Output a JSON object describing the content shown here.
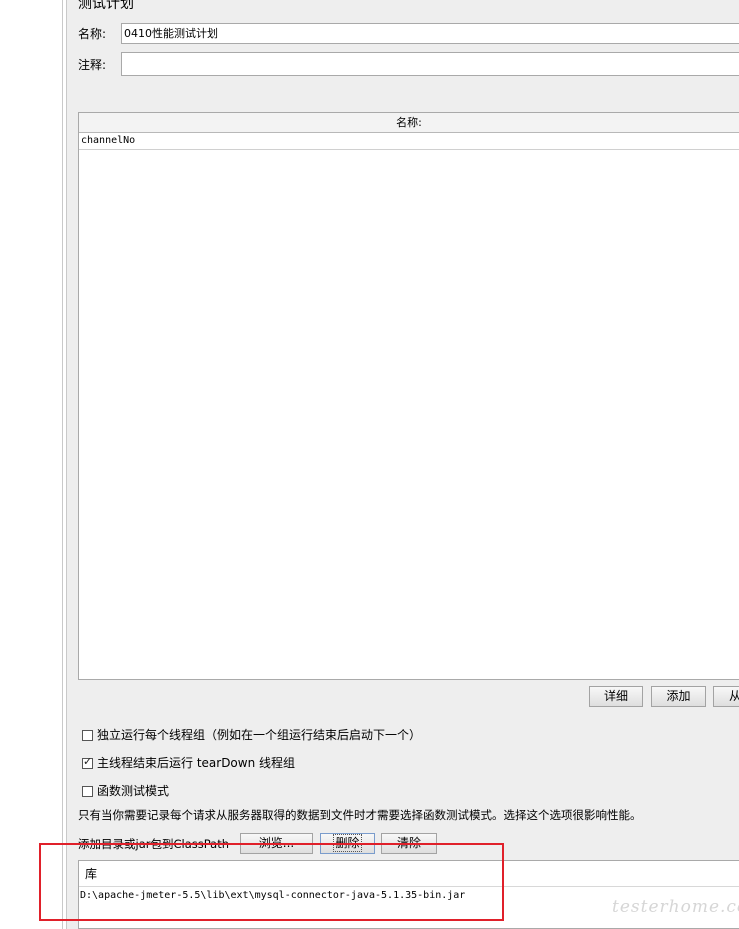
{
  "panel": {
    "title": "测试计划",
    "name_label": "名称:",
    "name_value": "0410性能测试计划",
    "comment_label": "注释:",
    "comment_value": ""
  },
  "variables_table": {
    "header": "名称:",
    "rows": [
      "channelNo"
    ]
  },
  "table_buttons": {
    "detail": "详细",
    "add": "添加",
    "clipboard_partial": "从"
  },
  "options": {
    "run_groups_consecutively": {
      "label": "独立运行每个线程组（例如在一个组运行结束后启动下一个）",
      "checked": false
    },
    "teardown_after_shutdown": {
      "label": "主线程结束后运行 tearDown 线程组",
      "checked": true
    },
    "functional_mode": {
      "label": "函数测试模式",
      "checked": false
    },
    "functional_note": "只有当你需要记录每个请求从服务器取得的数据到文件时才需要选择函数测试模式。选择这个选项很影响性能。"
  },
  "classpath": {
    "label": "添加目录或jar包到ClassPath",
    "browse": "浏览...",
    "delete": "删除",
    "clear": "清除",
    "table_header": "库",
    "entries": [
      "D:\\apache-jmeter-5.5\\lib\\ext\\mysql-connector-java-5.1.35-bin.jar"
    ]
  },
  "watermark": "testerhome.com",
  "colors": {
    "highlight": "#e0202a",
    "panel_bg": "#eeeeee"
  }
}
